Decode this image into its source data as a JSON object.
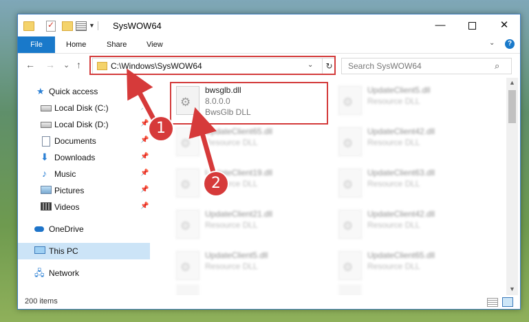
{
  "window": {
    "title": "SysWOW64",
    "minimize": "—",
    "close": "✕"
  },
  "ribbon": {
    "tabs": [
      "File",
      "Home",
      "Share",
      "View"
    ],
    "expand_glyph": "⌄",
    "help_glyph": "?"
  },
  "navigation": {
    "back_glyph": "←",
    "forward_glyph": "→",
    "recent_glyph": "⌄",
    "up_glyph": "↑",
    "address": "C:\\Windows\\SysWOW64",
    "refresh_glyph": "↻",
    "search_placeholder": "Search SysWOW64",
    "search_glyph": "⌕"
  },
  "sidebar": {
    "items": [
      {
        "label": "Quick access",
        "icon": "star-icon",
        "glyph": "★",
        "pinned": false
      },
      {
        "label": "Local Disk (C:)",
        "icon": "drive-icon",
        "glyph": "",
        "pinned": true
      },
      {
        "label": "Local Disk (D:)",
        "icon": "drive-icon",
        "glyph": "",
        "pinned": true
      },
      {
        "label": "Documents",
        "icon": "documents-icon",
        "glyph": "",
        "pinned": true
      },
      {
        "label": "Downloads",
        "icon": "downloads-icon",
        "glyph": "⬇",
        "pinned": true
      },
      {
        "label": "Music",
        "icon": "music-icon",
        "glyph": "♪",
        "pinned": true
      },
      {
        "label": "Pictures",
        "icon": "pictures-icon",
        "glyph": "",
        "pinned": true
      },
      {
        "label": "Videos",
        "icon": "videos-icon",
        "glyph": "",
        "pinned": true
      },
      {
        "label": "OneDrive",
        "icon": "onedrive-icon",
        "glyph": "",
        "pinned": false
      },
      {
        "label": "This PC",
        "icon": "this-pc-icon",
        "glyph": "",
        "pinned": false,
        "selected": true
      },
      {
        "label": "Network",
        "icon": "network-icon",
        "glyph": "🖧",
        "pinned": false
      }
    ],
    "pin_glyph": "📌"
  },
  "files": {
    "highlighted": {
      "name": "bwsglb.dll",
      "version": "8.0.0.0",
      "description": "BwsGlb DLL"
    },
    "blurred": [
      {
        "name": "UpdateClient5.dll",
        "description": "Resource DLL"
      },
      {
        "name": "UpdateClient65.dll",
        "description": "Resource DLL"
      },
      {
        "name": "UpdateClient42.dll",
        "description": "Resource DLL"
      },
      {
        "name": "UpdateClient19.dll",
        "description": "Resource DLL"
      },
      {
        "name": "UpdateClient63.dll",
        "description": "Resource DLL"
      },
      {
        "name": "UpdateClient21.dll",
        "description": "Resource DLL"
      },
      {
        "name": "UpdateClient42.dll",
        "description": "Resource DLL"
      },
      {
        "name": "UpdateClient5.dll",
        "description": "Resource DLL"
      },
      {
        "name": "UpdateClient65.dll",
        "description": "Resource DLL"
      }
    ]
  },
  "scrollbar": {
    "up_glyph": "▲",
    "down_glyph": "▼"
  },
  "status": {
    "item_count": "200 items"
  },
  "annotations": {
    "step1": "1",
    "step2": "2",
    "highlight_color": "#d33a3a"
  }
}
